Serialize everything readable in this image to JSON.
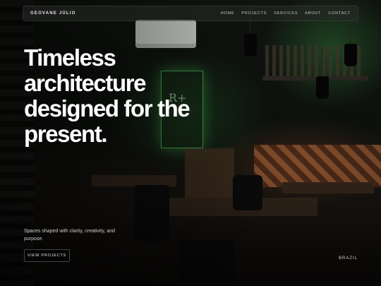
{
  "nav": {
    "brand": "GEOVANE JÚLIO",
    "items": [
      {
        "label": "HOME"
      },
      {
        "label": "PROJECTS"
      },
      {
        "label": "SERVICES"
      },
      {
        "label": "ABOUT"
      },
      {
        "label": "CONTACT"
      }
    ]
  },
  "hero": {
    "title": "Timeless architecture designed for the present.",
    "subtitle": "Spaces shaped with clarity, creativity, and purpose.",
    "cta_label": "VIEW PROJECTS",
    "location": "BRAZIL"
  }
}
